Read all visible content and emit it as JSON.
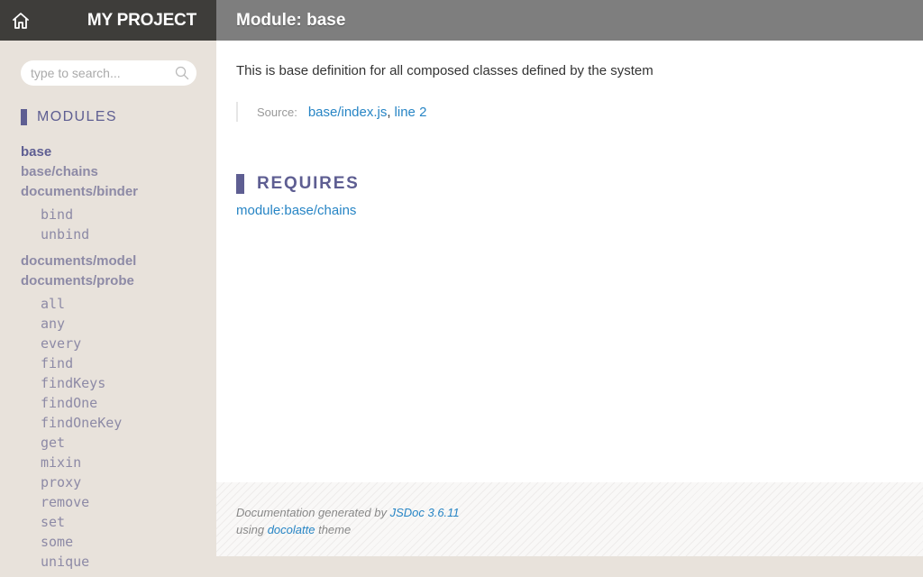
{
  "brand": {
    "title": "MY PROJECT",
    "home_icon": "home-icon"
  },
  "search": {
    "placeholder": "type to search..."
  },
  "nav": {
    "section_title": "MODULES",
    "groups": [
      {
        "label": "base",
        "active": true,
        "members": []
      },
      {
        "label": "base/chains",
        "members": []
      },
      {
        "label": "documents/binder",
        "members": [
          "bind",
          "unbind"
        ]
      },
      {
        "label": "documents/model",
        "members": []
      },
      {
        "label": "documents/probe",
        "members": [
          "all",
          "any",
          "every",
          "find",
          "findKeys",
          "findOne",
          "findOneKey",
          "get",
          "mixin",
          "proxy",
          "remove",
          "set",
          "some",
          "unique"
        ]
      }
    ]
  },
  "header": {
    "title": "Module: base"
  },
  "main": {
    "description": "This is base definition for all composed classes defined by the system",
    "source_label": "Source:",
    "source_file": "base/index.js",
    "source_sep": ",",
    "source_line": "line 2",
    "requires_title": "REQUIRES",
    "requires_link": "module:base/chains"
  },
  "footer": {
    "line1_prefix": "Documentation generated by",
    "line1_link": "JSDoc 3.6.11",
    "line2_prefix": "using",
    "line2_link": "docolatte",
    "line2_suffix": "theme"
  },
  "colors": {
    "accent": "#5e5e92",
    "link": "#2785c5",
    "topbar": "#7e7e7e",
    "brand_bg": "#3e3d3a",
    "sidebar_bg": "#e8e2db"
  }
}
